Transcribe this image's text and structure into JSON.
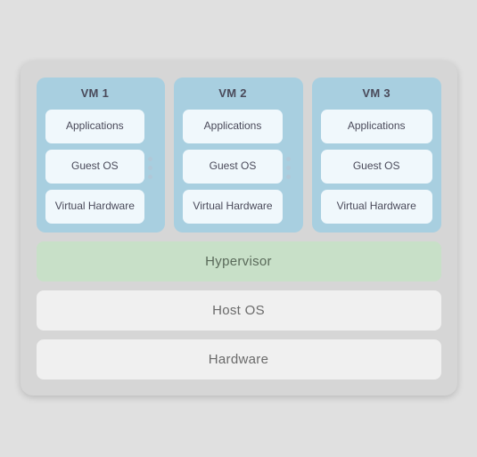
{
  "vms": [
    {
      "title": "VM 1",
      "layers": [
        {
          "label": "Applications"
        },
        {
          "label": "Guest OS"
        },
        {
          "label": "Virtual Hardware"
        }
      ]
    },
    {
      "title": "VM 2",
      "layers": [
        {
          "label": "Applications"
        },
        {
          "label": "Guest OS"
        },
        {
          "label": "Virtual Hardware"
        }
      ]
    },
    {
      "title": "VM 3",
      "layers": [
        {
          "label": "Applications"
        },
        {
          "label": "Guest OS"
        },
        {
          "label": "Virtual Hardware"
        }
      ]
    }
  ],
  "hypervisor": "Hypervisor",
  "hostos": "Host OS",
  "hardware": "Hardware"
}
